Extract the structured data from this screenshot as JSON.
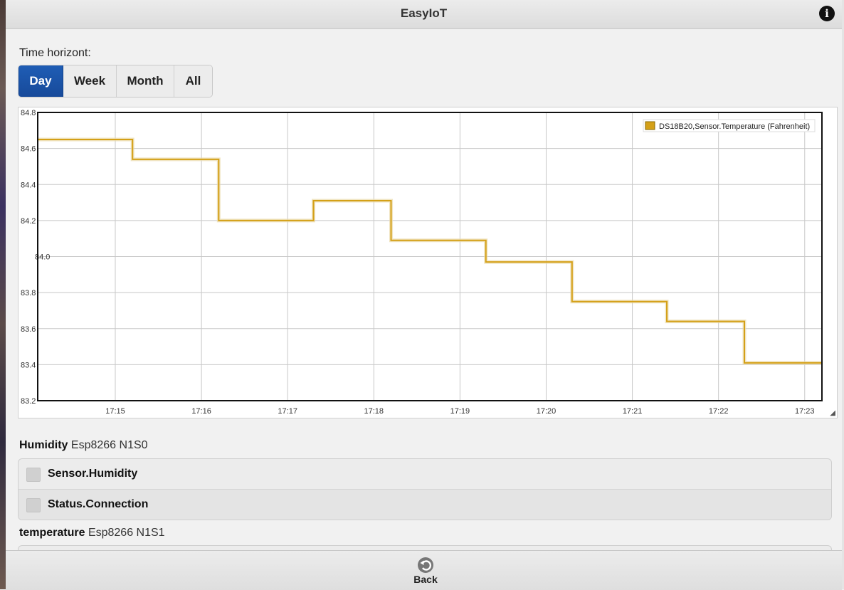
{
  "header": {
    "title": "EasyIoT",
    "info_icon": "info-icon"
  },
  "time_horizon": {
    "label": "Time horizont:",
    "options": [
      "Day",
      "Week",
      "Month",
      "All"
    ],
    "selected": "Day"
  },
  "chart_data": {
    "type": "line",
    "step": true,
    "series": [
      {
        "name": "DS18B20,Sensor.Temperature (Fahrenheit)",
        "color": "#d4a017",
        "x": [
          "17:14.1",
          "17:15.2",
          "17:16.2",
          "17:17.3",
          "17:18.2",
          "17:19.3",
          "17:20.3",
          "17:21.4",
          "17:22.3",
          "17:23.2"
        ],
        "y": [
          84.65,
          84.54,
          84.2,
          84.31,
          84.09,
          83.97,
          83.75,
          83.64,
          83.41,
          83.41
        ]
      }
    ],
    "y_ticks": [
      "84.8",
      "84.6",
      "84.4",
      "84.2",
      "84.0",
      "83.8",
      "83.6",
      "83.4",
      "83.2"
    ],
    "x_ticks": [
      "17:15",
      "17:16",
      "17:17",
      "17:18",
      "17:19",
      "17:20",
      "17:21",
      "17:22",
      "17:23"
    ],
    "ylim": [
      83.2,
      84.8
    ],
    "grid": true,
    "legend": "top-right"
  },
  "groups": [
    {
      "title": "Humidity",
      "subtitle": "Esp8266 N1S0",
      "items": [
        "Sensor.Humidity",
        "Status.Connection"
      ]
    },
    {
      "title": "temperature",
      "subtitle": "Esp8266 N1S1",
      "items": []
    }
  ],
  "footer": {
    "back_label": "Back",
    "back_icon": "back-arrow-icon"
  }
}
